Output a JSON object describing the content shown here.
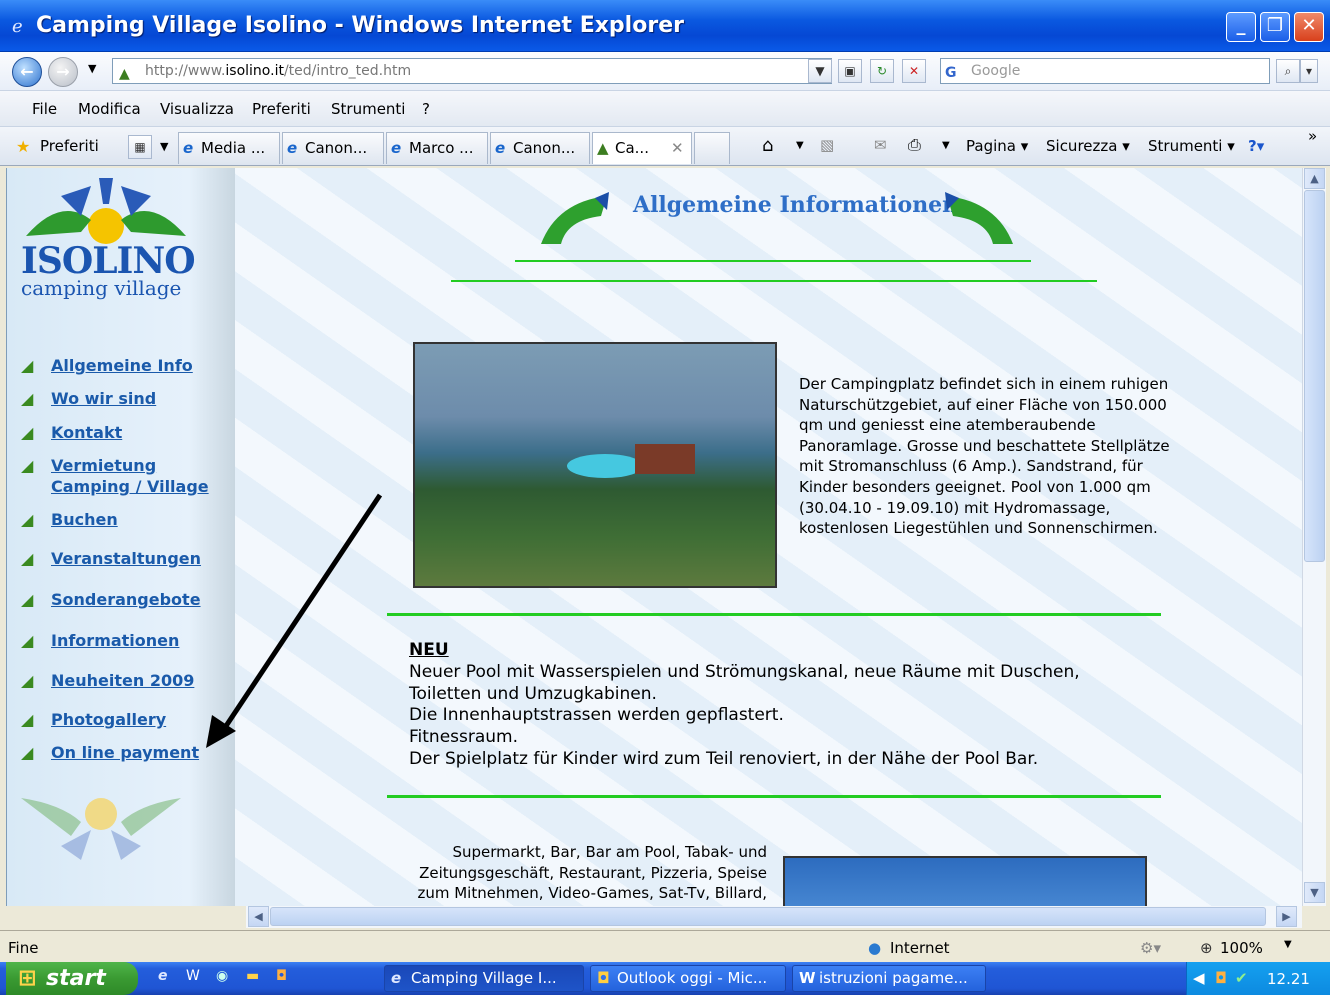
{
  "window": {
    "title": "Camping Village Isolino - Windows Internet Explorer",
    "app_icon": "ie-icon"
  },
  "address": {
    "prefix": "http://www.",
    "domain": "isolino.it",
    "path": "/ted/intro_ted.htm",
    "search_placeholder": "Google"
  },
  "menu": [
    "File",
    "Modifica",
    "Visualizza",
    "Preferiti",
    "Strumenti",
    "?"
  ],
  "favorites": {
    "label": "Preferiti"
  },
  "tabs": [
    "Media ...",
    "Canon...",
    "Marco ...",
    "Canon...",
    "Ca..."
  ],
  "commands": {
    "pagina": "Pagina",
    "sicurezza": "Sicurezza",
    "strumenti": "Strumenti"
  },
  "sidebar": {
    "logo_title": "ISOLINO",
    "logo_sub": "camping village",
    "items": [
      "Allgemeine Info",
      "Wo wir sind",
      "Kontakt",
      "Vermietung",
      "Camping / Village",
      "Buchen",
      "Veranstaltungen",
      "Sonderangebote",
      "Informationen",
      "Neuheiten 2009",
      "Photogallery",
      "On line payment"
    ]
  },
  "main": {
    "heading": "Allgemeine Informationen",
    "intro": "Der Campingplatz befindet sich in einem ruhigen Naturschützgebiet, auf einer Fläche von 150.000 qm und geniesst eine atemberaubende Panoramlage. Grosse und beschattete Stellplätze mit Stromanschluss (6 Amp.). Sandstrand, für Kinder besonders geeignet. Pool von 1.000 qm (30.04.10 - 19.09.10) mit Hydromassage, kostenlosen Liegestühlen und Sonnenschirmen.",
    "neu_heading": "NEU",
    "neu_lines": [
      "Neuer Pool mit Wasserspielen und Strömungskanal, neue Räume mit Duschen,",
      "Toiletten und Umzugkabinen.",
      "Die Innenhauptstrassen werden gepflastert.",
      "Fitnessraum.",
      "Der Spielplatz für Kinder wird zum Teil renoviert, in der Nähe der Pool Bar."
    ],
    "services": "Supermarkt, Bar, Bar am Pool, Tabak- und Zeitungsgeschäft, Restaurant, Pizzeria, Speise zum Mitnehmen, Video-Games, Sat-Tv, Billard,"
  },
  "status": {
    "text": "Fine",
    "zone": "Internet",
    "zoom": "100%"
  },
  "taskbar": {
    "start": "start",
    "buttons": [
      "Camping Village I...",
      "Outlook oggi - Mic...",
      "istruzioni pagame..."
    ],
    "clock": "12.21"
  },
  "colors": {
    "title_bar": "#0548d4",
    "link": "#1a5aaa",
    "green_rule": "#22cc22",
    "heading": "#2e6ec7"
  }
}
